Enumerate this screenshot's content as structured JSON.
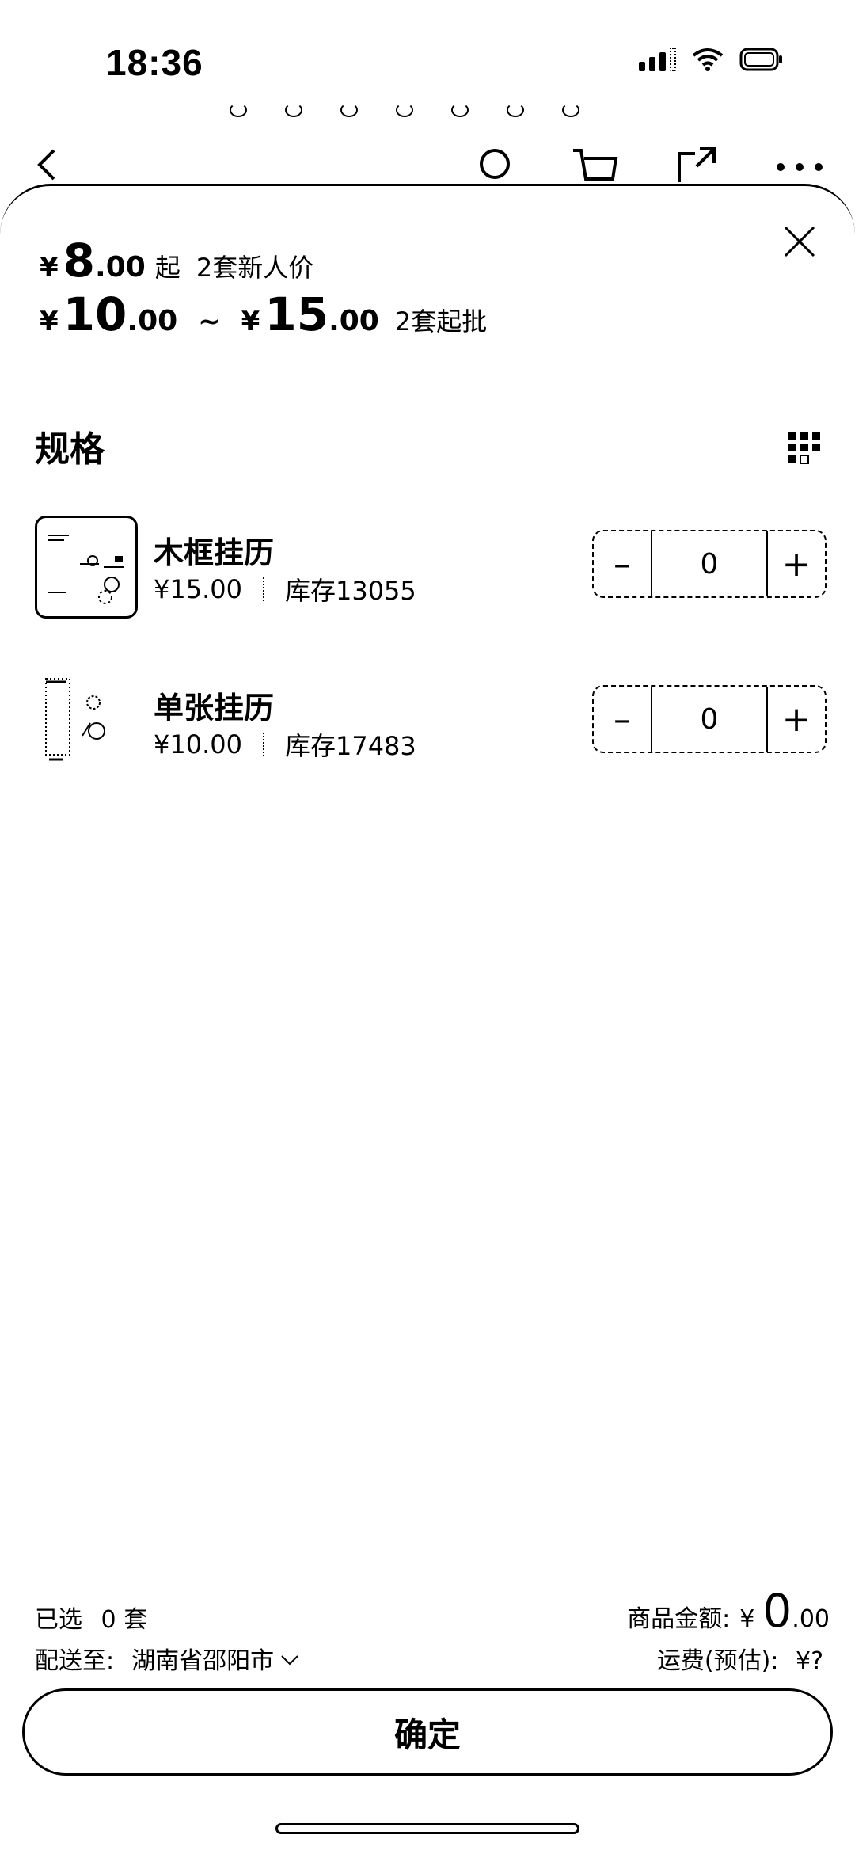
{
  "status_bar": {
    "time": "18:36"
  },
  "price": {
    "new_user": {
      "currency": "¥",
      "integer": "8",
      "cents": ".00",
      "qualifier": "起",
      "label": "2套新人价"
    },
    "wholesale": {
      "min_currency": "¥",
      "min_integer": "10",
      "min_cents": ".00",
      "separator": "~",
      "max_currency": "¥",
      "max_integer": "15",
      "max_cents": ".00",
      "label": "2套起批"
    }
  },
  "spec": {
    "title": "规格"
  },
  "items": [
    {
      "name": "木框挂历",
      "price": "¥15.00",
      "stock": "库存13055",
      "quantity": "0",
      "minus": "–",
      "plus": "+"
    },
    {
      "name": "单张挂历",
      "price": "¥10.00",
      "stock": "库存17483",
      "quantity": "0",
      "minus": "–",
      "plus": "+"
    }
  ],
  "footer": {
    "selected_label": "已选",
    "selected_count": "0",
    "selected_unit": "套",
    "amount_label": "商品金额:",
    "amount_currency": "¥",
    "amount_integer": "0",
    "amount_cents": ".00",
    "ship_label": "配送至:",
    "ship_address": "湖南省邵阳市",
    "freight_label": "运费(预估):",
    "freight_value": "¥?"
  },
  "confirm": {
    "label": "确定"
  },
  "icons": {
    "back": "chevron-left-icon",
    "search": "search-icon",
    "cart": "cart-icon",
    "share": "share-icon",
    "more": "more-icon",
    "close": "close-icon",
    "grid": "grid-view-icon",
    "dropdown": "chevron-down-icon"
  }
}
